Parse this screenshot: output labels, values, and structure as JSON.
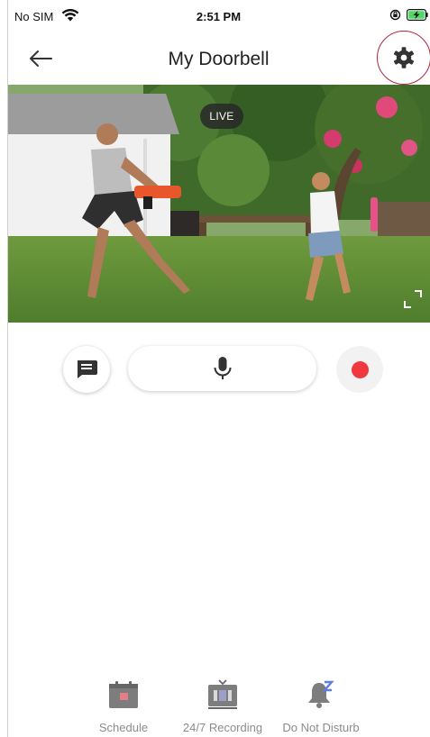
{
  "status_bar": {
    "carrier": "No SIM",
    "time": "2:51 PM"
  },
  "header": {
    "title": "My Doorbell",
    "back_icon": "arrow-left-icon",
    "settings_icon": "gear-icon"
  },
  "video": {
    "live_label": "LIVE",
    "fullscreen_icon": "expand-icon"
  },
  "controls": {
    "chat_icon": "message-icon",
    "mic_icon": "microphone-icon",
    "record_icon": "record-icon",
    "record_color": "#f0383f"
  },
  "bottom_nav": {
    "items": [
      {
        "label": "Schedule",
        "icon": "calendar-icon"
      },
      {
        "label": "24/7 Recording",
        "icon": "recording-icon"
      },
      {
        "label": "Do Not Disturb",
        "icon": "bell-snooze-icon"
      }
    ]
  },
  "colors": {
    "accent_ring": "#b2263f",
    "nav_icon": "#7d7d7d",
    "nav_label": "#8c8c8c",
    "snooze_badge": "#5b7fe0"
  }
}
